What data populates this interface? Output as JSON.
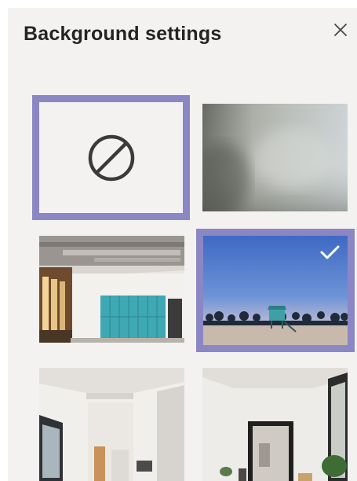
{
  "header": {
    "title": "Background settings",
    "close_icon": "close-icon"
  },
  "backgrounds": [
    {
      "kind": "none",
      "icon": "no-background-icon",
      "selected": false
    },
    {
      "kind": "blur",
      "selected": false
    },
    {
      "kind": "image",
      "subject": "office-lockers",
      "selected": false
    },
    {
      "kind": "image",
      "subject": "beach-lifeguard-tower",
      "selected": true,
      "indicator_icon": "checkmark-icon"
    },
    {
      "kind": "image",
      "subject": "bright-room",
      "selected": false
    },
    {
      "kind": "image",
      "subject": "room-with-mirror",
      "selected": false
    }
  ],
  "colors": {
    "panel_background": "#f3f2f1",
    "selection_border": "#8b87c4",
    "title_text": "#252423"
  }
}
